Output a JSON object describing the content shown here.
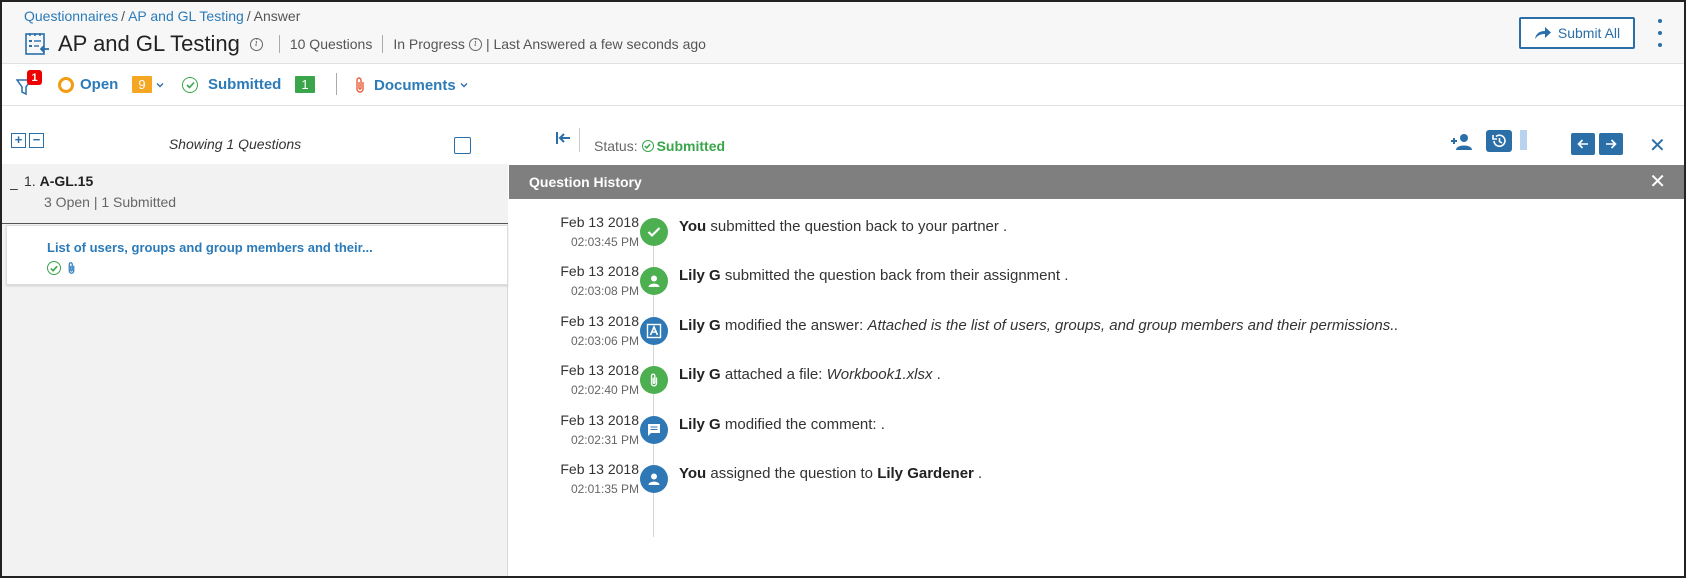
{
  "breadcrumb": {
    "root": "Questionnaires",
    "sep1": "/",
    "parent": "AP and GL Testing",
    "sep2": "/",
    "current": "Answer"
  },
  "header": {
    "title": "AP and GL Testing",
    "questions_count": "10 Questions",
    "status": "In Progress",
    "last_answered": "| Last Answered a few seconds ago",
    "submit_all": "Submit All"
  },
  "filters": {
    "filter_badge": "1",
    "open_label": "Open",
    "open_count": "9",
    "submitted_label": "Submitted",
    "submitted_count": "1",
    "documents_label": "Documents"
  },
  "left_panel": {
    "expand": "+",
    "collapse": "−",
    "showing": "Showing 1 Questions",
    "group": {
      "toggle": "–",
      "number": "1.",
      "id": "A-GL.15",
      "summary": "3  Open | 1 Submitted"
    },
    "question": {
      "title": "List of users, groups and group members and their..."
    }
  },
  "right_panel": {
    "status_label": "Status:",
    "status_value": "Submitted",
    "history_title": "Question History",
    "close": "✕",
    "entries": [
      {
        "date": "Feb 13 2018",
        "time": "02:03:45 PM",
        "icon": "check-icon",
        "color": "green",
        "actor": "You",
        "text": " submitted the question back to your partner .",
        "italic": "",
        "tail": "",
        "target": ""
      },
      {
        "date": "Feb 13 2018",
        "time": "02:03:08 PM",
        "icon": "user-icon",
        "color": "green",
        "actor": "Lily G",
        "text": " submitted the question back from their assignment .",
        "italic": "",
        "tail": "",
        "target": ""
      },
      {
        "date": "Feb 13 2018",
        "time": "02:03:06 PM",
        "icon": "answer-icon",
        "color": "blue",
        "actor": "Lily G",
        "text": " modified the answer: ",
        "italic": "Attached is the list of users, groups, and group members and their permissions..",
        "tail": "",
        "target": ""
      },
      {
        "date": "Feb 13 2018",
        "time": "02:02:40 PM",
        "icon": "paperclip-icon",
        "color": "green",
        "actor": "Lily G",
        "text": " attached a file: ",
        "italic": "Workbook1.xlsx",
        "tail": " .",
        "target": ""
      },
      {
        "date": "Feb 13 2018",
        "time": "02:02:31 PM",
        "icon": "comment-icon",
        "color": "blue",
        "actor": "Lily G",
        "text": " modified the comment: .",
        "italic": "",
        "tail": "",
        "target": ""
      },
      {
        "date": "Feb 13 2018",
        "time": "02:01:35 PM",
        "icon": "user-icon",
        "color": "blue",
        "actor": "You",
        "text": " assigned the question to ",
        "italic": "",
        "tail": " .",
        "target": "Lily Gardener"
      }
    ]
  },
  "colors": {
    "accent": "#2b7bb9",
    "open": "#f5a623",
    "submitted": "#3aa54a",
    "history_bar": "#7f7f7f"
  }
}
